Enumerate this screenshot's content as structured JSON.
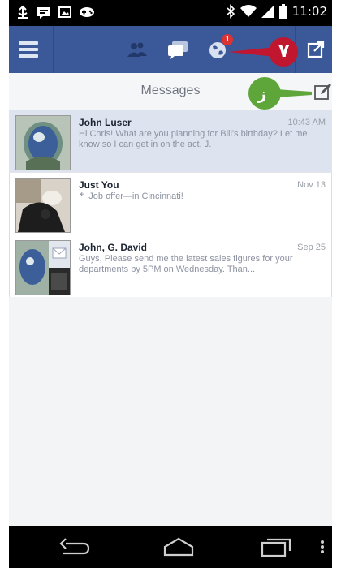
{
  "status_bar": {
    "time": "11:02",
    "icons": [
      "usb-icon",
      "chat-icon",
      "image-icon",
      "gamepad-icon",
      "bluetooth-icon",
      "wifi-icon",
      "signal-icon",
      "battery-icon"
    ]
  },
  "action_bar": {
    "icons": [
      "menu-icon",
      "friends-icon",
      "messages-icon",
      "notifications-globe-icon",
      "share-icon"
    ],
    "notification_count": "1",
    "brand_color": "#3b5998"
  },
  "callouts": {
    "red": "٧",
    "green": "ز"
  },
  "header": {
    "title": "Messages"
  },
  "messages": [
    {
      "name": "John Luser",
      "time": "10:43 AM",
      "snippet": "Hi Chris! What are you planning for Bill's birthday? Let me know so I can get in on the act. J."
    },
    {
      "name": "Just You",
      "time": "Nov 13",
      "snippet": "↰ Job offer—in Cincinnati!"
    },
    {
      "name": "John, G. David",
      "time": "Sep 25",
      "snippet": "Guys,    Please send me the latest sales figures for your departments by 5PM on Wednesday.    Than..."
    }
  ],
  "nav_bar": {
    "icons": [
      "back-icon",
      "home-icon",
      "recent-apps-icon",
      "overflow-icon"
    ]
  }
}
